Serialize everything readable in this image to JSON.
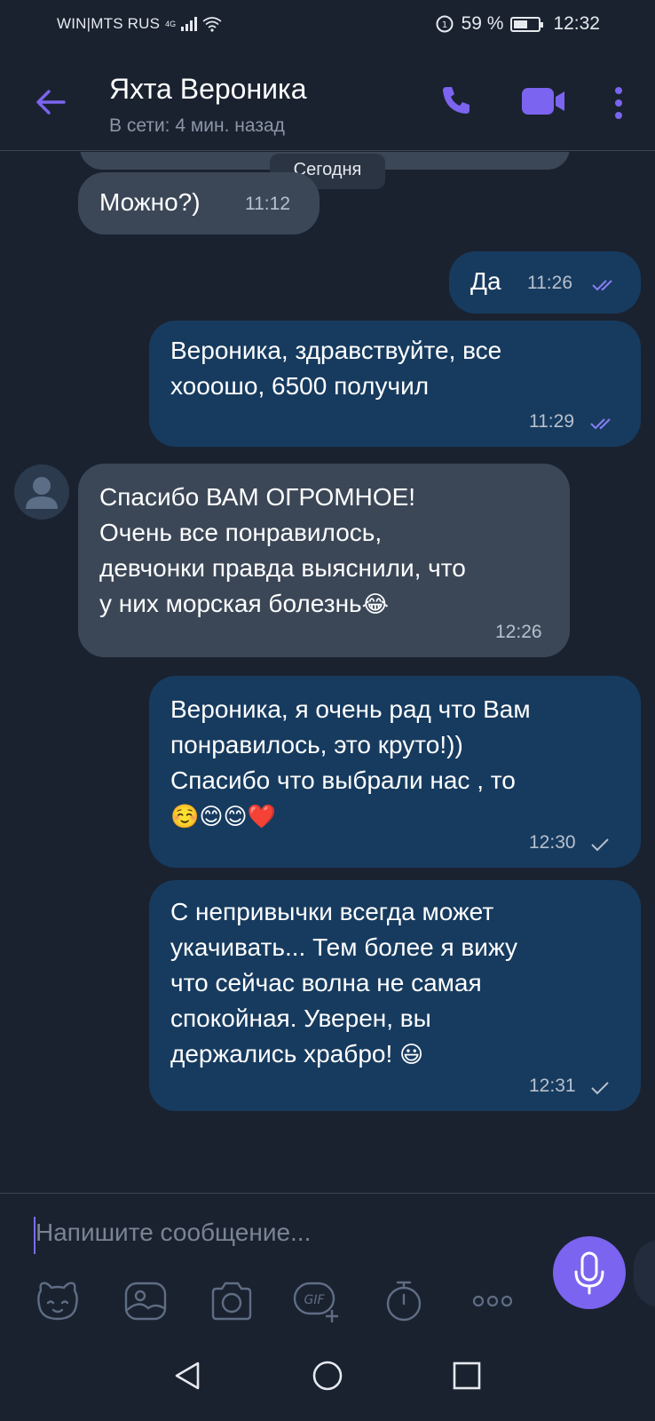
{
  "status_bar": {
    "carrier": "WIN|MTS RUS",
    "network": "4G",
    "battery_percent": "59 %",
    "battery_level": 0.59,
    "time": "12:32"
  },
  "header": {
    "title": "Яхта Вероника",
    "subtitle": "В сети: 4 мин. назад"
  },
  "chat": {
    "date_separator": "Сегодня",
    "messages": [
      {
        "direction": "in",
        "text": "Можно?)",
        "time": "11:12"
      },
      {
        "direction": "out",
        "text": "Да",
        "time": "11:26",
        "status": "read"
      },
      {
        "direction": "out",
        "text": "Вероника, здравствуйте, все\nхооошо, 6500 получил",
        "time": "11:29",
        "status": "read"
      },
      {
        "direction": "in",
        "text": "Спасибо ВАМ ОГРОМНОЕ!\nОчень все понравилось,\nдевчонки правда выяснили, что\nу них морская болезнь",
        "emoji": "😂",
        "time": "12:26"
      },
      {
        "direction": "out",
        "text": "Вероника, я очень рад что Вам\nпонравилось, это круто!))\nСпасибо что выбрали нас , то",
        "emoji_line": "☺️😊😊❤️",
        "time": "12:30",
        "status": "sent"
      },
      {
        "direction": "out",
        "text": "С непривычки всегда может\nукачивать... Тем более я вижу\nчто сейчас волна не самая\nспокойная. Уверен, вы\nдержались храбро!",
        "emoji": "😃",
        "time": "12:31",
        "status": "sent"
      }
    ]
  },
  "composer": {
    "placeholder": "Напишите сообщение...",
    "tools": [
      "sticker-icon",
      "gallery-icon",
      "camera-icon",
      "gif-icon",
      "timer-icon",
      "more-dots-icon"
    ],
    "gif_label": "GIF"
  },
  "colors": {
    "background": "#1a2230",
    "incoming_bubble": "#3b4757",
    "outgoing_bubble": "#173b5f",
    "accent": "#7b64ef"
  }
}
